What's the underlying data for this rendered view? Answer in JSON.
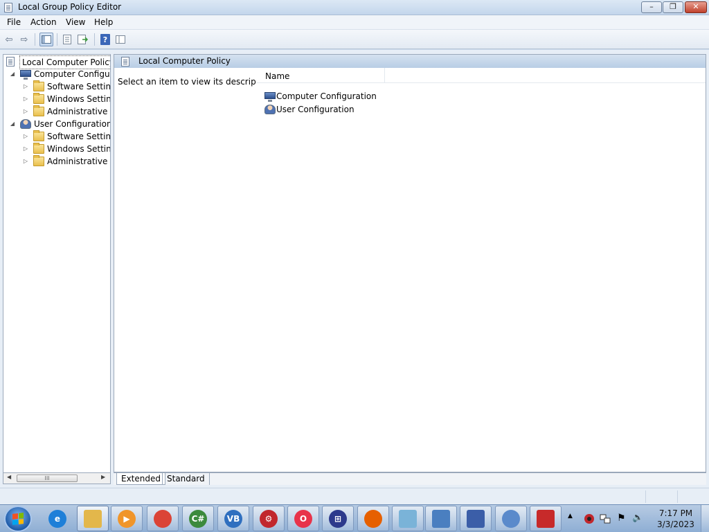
{
  "window": {
    "title": "Local Group Policy Editor",
    "controls": {
      "minimize": "–",
      "maximize": "❐",
      "close": "✕"
    }
  },
  "menu": [
    "File",
    "Action",
    "View",
    "Help"
  ],
  "toolbar": {
    "back": "⇦",
    "forward": "⇨",
    "help": "?"
  },
  "tree": {
    "root": "Local Computer Policy",
    "nodes": [
      {
        "label": "Computer Configura",
        "icon": "computer-icon",
        "expander": "◢"
      },
      {
        "label": "Software Settings",
        "icon": "folder-icon",
        "expander": "▷"
      },
      {
        "label": "Windows Setting:",
        "icon": "folder-icon",
        "expander": "▷"
      },
      {
        "label": "Administrative Te",
        "icon": "folder-icon",
        "expander": "▷"
      },
      {
        "label": "User Configuration",
        "icon": "user-icon",
        "expander": "◢"
      },
      {
        "label": "Software Settings",
        "icon": "folder-icon",
        "expander": "▷"
      },
      {
        "label": "Windows Setting:",
        "icon": "folder-icon",
        "expander": "▷"
      },
      {
        "label": "Administrative Te",
        "icon": "folder-icon",
        "expander": "▷"
      }
    ],
    "scroll": {
      "left": "◀",
      "right": "▶",
      "grip": "III"
    }
  },
  "details": {
    "header_title": "Local Computer Policy",
    "description": "Select an item to view its description.",
    "column_name": "Name",
    "items": [
      {
        "label": "Computer Configuration",
        "icon": "computer-icon"
      },
      {
        "label": "User Configuration",
        "icon": "user-icon"
      }
    ]
  },
  "tabs": {
    "extended": "Extended",
    "standard": "Standard"
  },
  "taskbar": {
    "apps": [
      {
        "name": "internet-explorer-icon",
        "glyph": "e",
        "color": "#1e7fd8"
      },
      {
        "name": "file-explorer-icon",
        "glyph": "",
        "color": "#e3b74b"
      },
      {
        "name": "media-player-icon",
        "glyph": "▶",
        "color": "#f0952a"
      },
      {
        "name": "chrome-icon",
        "glyph": "",
        "color": "#db4437"
      },
      {
        "name": "csharp-icon",
        "glyph": "C#",
        "color": "#3c8a3c"
      },
      {
        "name": "vb-icon",
        "glyph": "VB",
        "color": "#2f6fbf"
      },
      {
        "name": "gear-app-icon",
        "glyph": "⚙",
        "color": "#c1272d"
      },
      {
        "name": "opera-icon",
        "glyph": "O",
        "color": "#e8334a"
      },
      {
        "name": "windows-store-icon",
        "glyph": "⊞",
        "color": "#2d3a8c"
      },
      {
        "name": "firefox-icon",
        "glyph": "",
        "color": "#e66000"
      },
      {
        "name": "notepad-icon",
        "glyph": "",
        "color": "#7ab3d8"
      },
      {
        "name": "control-panel-icon",
        "glyph": "",
        "color": "#4a7fc0"
      },
      {
        "name": "remote-desktop-icon",
        "glyph": "",
        "color": "#3b5ea8"
      },
      {
        "name": "users-icon",
        "glyph": "",
        "color": "#5a8acb"
      },
      {
        "name": "toolbox-icon",
        "glyph": "",
        "color": "#c72a2a"
      }
    ],
    "tray": {
      "arrow": "▲",
      "flag": "⚑",
      "volume": "🔈"
    },
    "clock": {
      "time": "7:17 PM",
      "date": "3/3/2023"
    }
  }
}
